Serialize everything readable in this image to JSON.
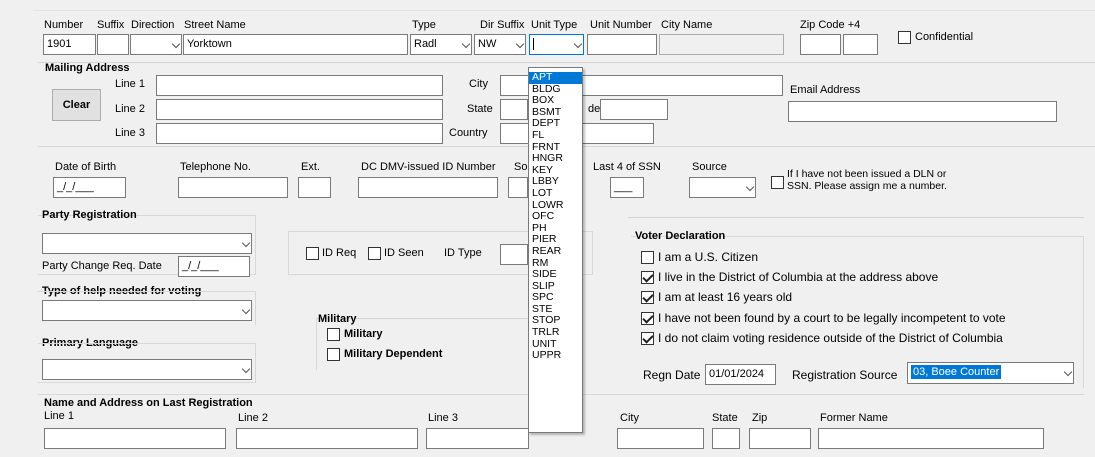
{
  "address": {
    "labels": {
      "number": "Number",
      "suffix": "Suffix",
      "direction": "Direction",
      "street": "Street Name",
      "type": "Type",
      "dir_suffix": "Dir Suffix",
      "unit_type": "Unit Type",
      "unit_number": "Unit Number",
      "city_name": "City Name",
      "zip": "Zip Code +4"
    },
    "values": {
      "number": "1901",
      "suffix": "",
      "direction": "",
      "street": "Yorktown",
      "type": "Radl",
      "dir_suffix": "NW",
      "unit_type": "",
      "unit_number": "",
      "city_name": "",
      "zip": "",
      "zip4": ""
    },
    "confidential_label": "Confidential",
    "confidential_checked": false
  },
  "mailing": {
    "title": "Mailing Address",
    "line1": "Line 1",
    "line2": "Line 2",
    "line3": "Line 3",
    "clear": "Clear",
    "city": "City",
    "state": "State",
    "country": "Country",
    "zip_suffix": "de",
    "email": "Email Address"
  },
  "personal": {
    "dob": "Date of Birth",
    "dob_value": "_/_/___",
    "phone": "Telephone No.",
    "ext": "Ext.",
    "dmv": "DC DMV-issued ID Number",
    "so": "So",
    "ssn": "Last 4 of SSN",
    "ssn_value": "___",
    "source": "Source",
    "no_dln": "If I have not been issued a DLN or SSN. Please assign me a number."
  },
  "party": {
    "title": "Party Registration",
    "change_label": "Party Change Req. Date",
    "change_value": "_/_/___"
  },
  "help": {
    "title": "Type of help needed for voting"
  },
  "language": {
    "title": "Primary Language"
  },
  "id": {
    "req": "ID Req",
    "seen": "ID Seen",
    "type": "ID Type"
  },
  "military": {
    "title": "Military",
    "military": "Military",
    "dependent": "Military Dependent"
  },
  "voter": {
    "title": "Voter Declaration",
    "items": [
      {
        "text": "I am a U.S. Citizen",
        "checked": false
      },
      {
        "text": "I live in the District of Columbia at the address above",
        "checked": true
      },
      {
        "text": "I am at least 16 years old",
        "checked": true
      },
      {
        "text": "I have not been found by a court to be legally incompetent to vote",
        "checked": true
      },
      {
        "text": "I do not claim voting residence outside of the District of Columbia",
        "checked": true
      }
    ],
    "regn_date_label": "Regn Date",
    "regn_date": "01/01/2024",
    "reg_source_label": "Registration Source",
    "reg_source": "03, Boee Counter"
  },
  "last_reg": {
    "title": "Name and Address on Last Registration",
    "line1": "Line 1",
    "line2": "Line 2",
    "line3": "Line 3",
    "city": "City",
    "state": "State",
    "zip": "Zip",
    "former": "Former Name"
  },
  "unit_type_options": [
    "APT",
    "BLDG",
    "BOX",
    "BSMT",
    "DEPT",
    "FL",
    "FRNT",
    "HNGR",
    "KEY",
    "LBBY",
    "LOT",
    "LOWR",
    "OFC",
    "PH",
    "PIER",
    "REAR",
    "RM",
    "SIDE",
    "SLIP",
    "SPC",
    "STE",
    "STOP",
    "TRLR",
    "UNIT",
    "UPPR"
  ],
  "unit_type_selected_index": 0
}
